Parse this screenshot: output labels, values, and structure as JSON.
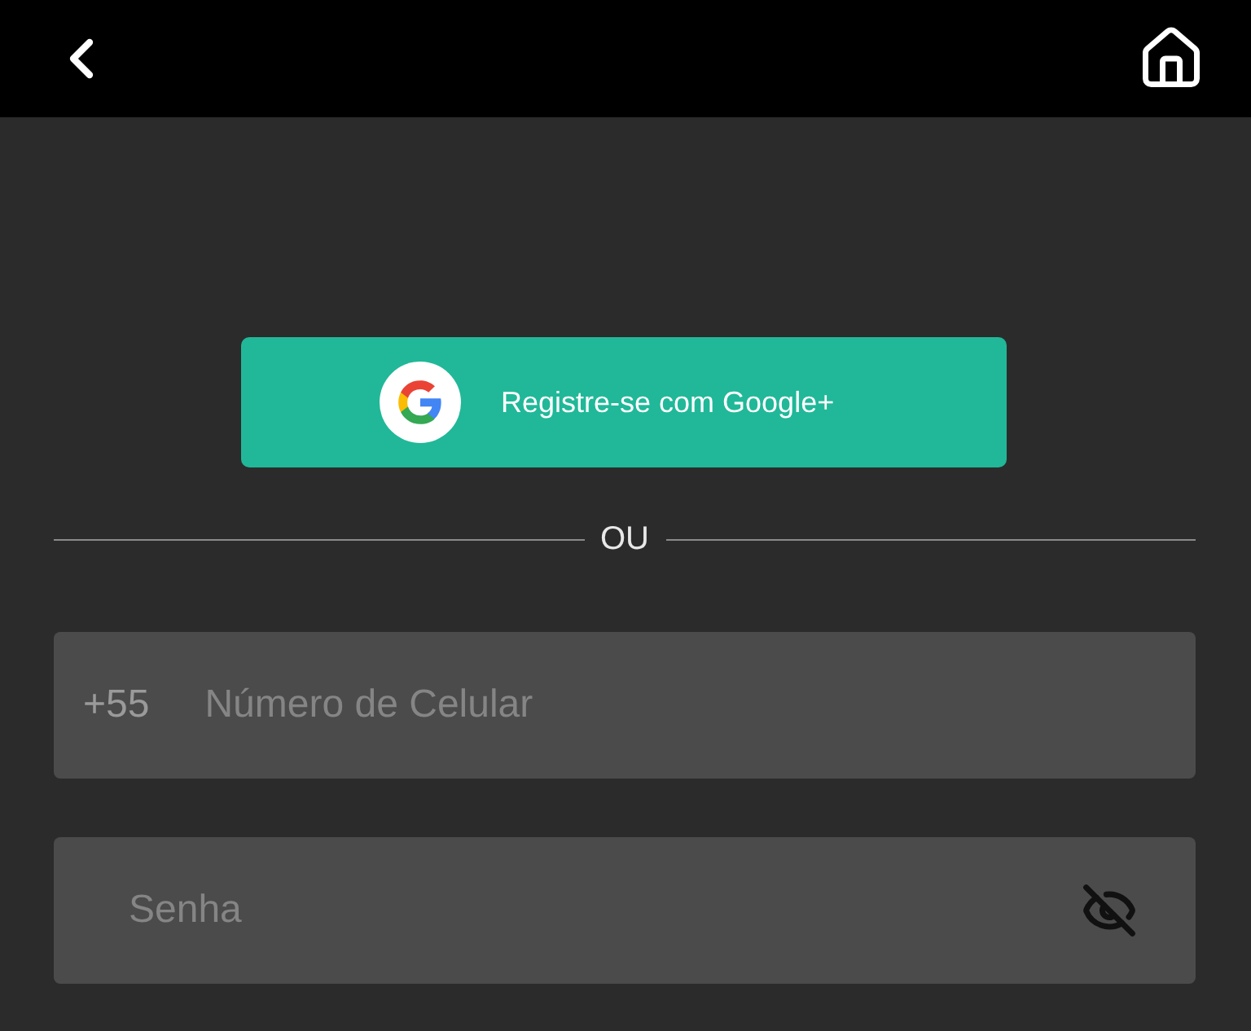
{
  "google_button": {
    "label": "Registre-se com Google+"
  },
  "divider": {
    "label": "OU"
  },
  "phone_field": {
    "prefix": "+55",
    "placeholder": "Número de Celular"
  },
  "password_field": {
    "placeholder": "Senha",
    "visible": false
  }
}
